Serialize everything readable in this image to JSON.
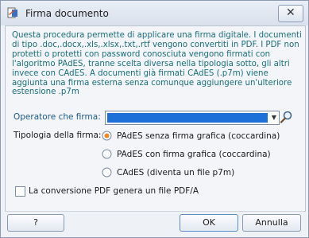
{
  "window": {
    "title": "Firma documento"
  },
  "description": "Questa procedura permette di applicare una firma digitale. I documenti di tipo .doc,.docx,.xls,.xlsx,.txt,.rtf vengono convertiti in PDF. I PDF non protetti o protetti con password conosciuta vengono firmati con l'algoritmo PAdES, tranne scelta diversa nella tipologia sotto, gli altri invece con CAdES. A documenti già firmati CAdES (.p7m) viene aggiunta una firma esterna senza comunque aggiungere un'ulteriore estensione .p7m",
  "operator": {
    "label": "Operatore che firma:",
    "value": ""
  },
  "signature_type": {
    "label": "Tipologia della firma:",
    "options": [
      {
        "label": "PAdES senza firma grafica (coccardina)",
        "selected": true
      },
      {
        "label": "PAdES con firma grafica (coccardina)",
        "selected": false
      },
      {
        "label": "CAdES (diventa un file p7m)",
        "selected": false
      }
    ]
  },
  "pdfa_checkbox": {
    "label": "La conversione PDF genera un file PDF/A",
    "checked": false
  },
  "buttons": {
    "help": "?",
    "ok": "OK",
    "cancel": "Annulla"
  },
  "colors": {
    "accent": "#1c70d8",
    "description_text": "#1a6e7c"
  }
}
